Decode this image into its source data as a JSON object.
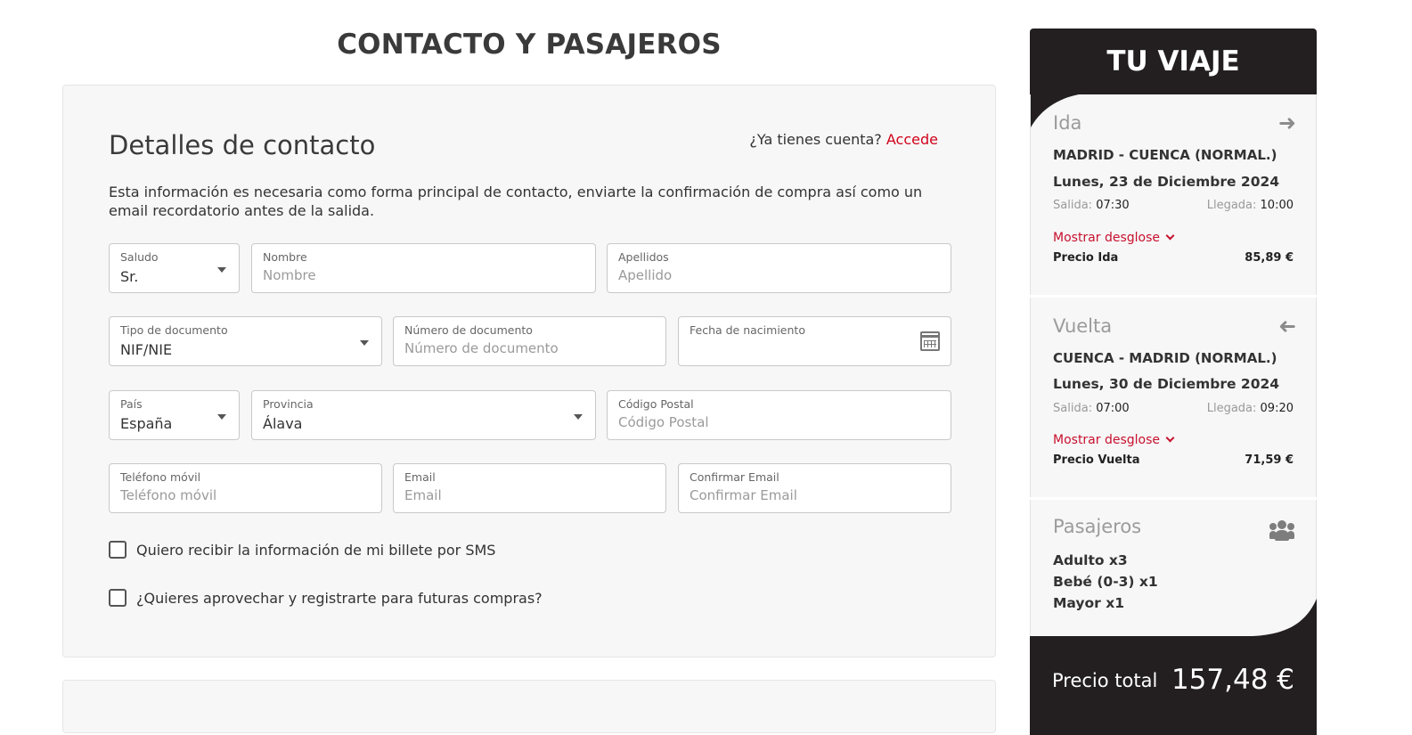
{
  "page_title": "CONTACTO Y PASAJEROS",
  "contact": {
    "title": "Detalles de contacto",
    "account_prompt": "¿Ya tienes cuenta?",
    "login_link": "Accede",
    "intro": "Esta información es necesaria como forma principal de contacto, enviarte la confirmación de compra así como un email recordatorio antes de la salida.",
    "fields": {
      "salutation": {
        "label": "Saludo",
        "value": "Sr."
      },
      "first_name": {
        "label": "Nombre",
        "placeholder": "Nombre"
      },
      "last_name": {
        "label": "Apellidos",
        "placeholder": "Apellido"
      },
      "doc_type": {
        "label": "Tipo de documento",
        "value": "NIF/NIE"
      },
      "doc_number": {
        "label": "Número de documento",
        "placeholder": "Número de documento"
      },
      "birth_date": {
        "label": "Fecha de nacimiento"
      },
      "country": {
        "label": "País",
        "value": "España"
      },
      "province": {
        "label": "Provincia",
        "value": "Álava"
      },
      "postal_code": {
        "label": "Código Postal",
        "placeholder": "Código Postal"
      },
      "mobile": {
        "label": "Teléfono móvil",
        "placeholder": "Teléfono móvil"
      },
      "email": {
        "label": "Email",
        "placeholder": "Email"
      },
      "email_confirm": {
        "label": "Confirmar Email",
        "placeholder": "Confirmar Email"
      }
    },
    "checkboxes": {
      "sms": "Quiero recibir la información de mi billete por SMS",
      "register": "¿Quieres aprovechar y registrarte para futuras compras?"
    }
  },
  "trip": {
    "title": "TU VIAJE",
    "outbound": {
      "title": "Ida",
      "route": "MADRID - CUENCA (NORMAL.)",
      "date": "Lunes, 23 de Diciembre 2024",
      "dep_label": "Salida:",
      "dep_time": "07:30",
      "arr_label": "Llegada:",
      "arr_time": "10:00",
      "breakdown": "Mostrar desglose",
      "price_label": "Precio Ida",
      "price": "85,89 €"
    },
    "return": {
      "title": "Vuelta",
      "route": "CUENCA - MADRID (NORMAL.)",
      "date": "Lunes, 30 de Diciembre 2024",
      "dep_label": "Salida:",
      "dep_time": "07:00",
      "arr_label": "Llegada:",
      "arr_time": "09:20",
      "breakdown": "Mostrar desglose",
      "price_label": "Precio Vuelta",
      "price": "71,59 €"
    },
    "passengers": {
      "title": "Pasajeros",
      "items": [
        "Adulto x3",
        "Bebé (0-3) x1",
        "Mayor x1"
      ]
    },
    "total_label": "Precio total",
    "total_value": "157,48 €"
  },
  "colors": {
    "accent": "#c8102e",
    "dark": "#231f20",
    "panel": "#f7f7f7"
  },
  "icons": [
    "arrow-right-icon",
    "arrow-left-icon",
    "users-icon",
    "calendar-icon",
    "chevron-down-icon"
  ]
}
